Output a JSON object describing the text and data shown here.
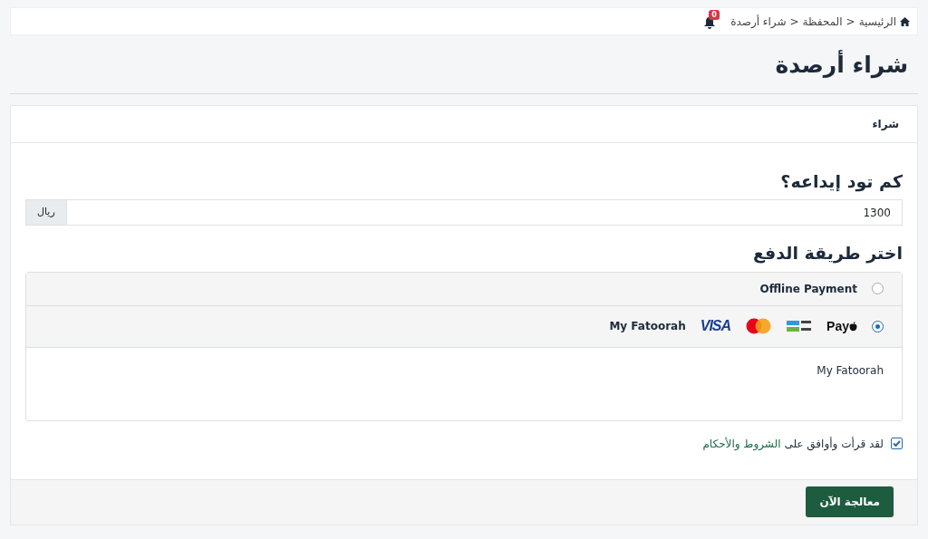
{
  "breadcrumb": [
    {
      "kind": "home",
      "label": "الرئيسية"
    },
    {
      "kind": "separator",
      "label": "<"
    },
    {
      "kind": "link",
      "label": "المحفظة"
    },
    {
      "kind": "separator",
      "label": "<"
    },
    {
      "kind": "current",
      "label": "شراء أرصدة"
    }
  ],
  "notifications": {
    "count": "0"
  },
  "page_title": "شراء أرصدة",
  "card": {
    "header": "شراء",
    "amount": {
      "heading": "كم تود إيداعه؟",
      "value": "1300",
      "currency": "ريال"
    },
    "payment": {
      "heading": "اختر طريقة الدفع",
      "methods": [
        {
          "label": "Offline Payment",
          "selected": false
        },
        {
          "label": "My Fatoorah",
          "selected": true,
          "logos": [
            {
              "kind": "applepay",
              "text": "Pay"
            },
            {
              "kind": "mada"
            },
            {
              "kind": "mastercard"
            },
            {
              "kind": "visa",
              "text": "VISA"
            }
          ],
          "details": "My Fatoorah"
        }
      ]
    },
    "terms": {
      "checked": true,
      "text": "لقد قرأت وأوافق على",
      "link": "الشروط والأحكام"
    },
    "submit": "معالجة الآن"
  }
}
